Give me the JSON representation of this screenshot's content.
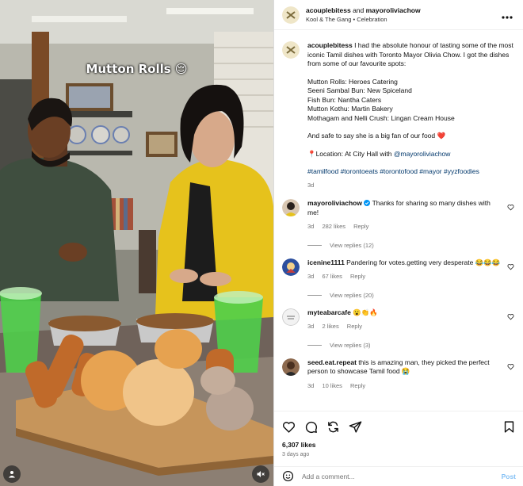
{
  "media": {
    "overlay_text": "Mutton Rolls 😌",
    "icons": [
      "user-icon",
      "mute-icon"
    ]
  },
  "header": {
    "user1": "acouplebitess",
    "and_text": "and",
    "user2": "mayoroliviachow",
    "audio": "Kool & The Gang",
    "separator": "•",
    "audio_tag": "Celebration"
  },
  "caption": {
    "username": "acouplebitess",
    "intro": "I had the absolute honour of tasting some of the most iconic Tamil dishes with Toronto Mayor Olivia Chow. I got the dishes from some of our favourite spots:",
    "spots": [
      "Mutton Rolls: Heroes Catering",
      "Seeni Sambal Bun: New Spiceland",
      "Fish Bun: Nantha Caters",
      "Mutton Kothu: Martin Bakery",
      "Mothagam and Nelli Crush: Lingan Cream House"
    ],
    "fan_line": "And safe to say she is a big fan of our food ❤️",
    "location_prefix": "📍Location: At City Hall with",
    "location_mention": "@mayoroliviachow",
    "hashtags": "#tamilfood #torontoeats #torontofood #mayor #yyzfoodies",
    "time": "3d"
  },
  "comments": [
    {
      "username": "mayoroliviachow",
      "verified": true,
      "text": "Thanks for sharing so many dishes with me!",
      "time": "3d",
      "likes": "282 likes",
      "reply": "Reply",
      "view_replies": "View replies (12)"
    },
    {
      "username": "icenine1111",
      "text": "Pandering for votes.getting very desperate 😂😂😂",
      "time": "3d",
      "likes": "67 likes",
      "reply": "Reply",
      "view_replies": "View replies (20)"
    },
    {
      "username": "myteabarcafe",
      "text": "😮👏🔥",
      "time": "3d",
      "likes": "2 likes",
      "reply": "Reply",
      "view_replies": "View replies (3)"
    },
    {
      "username": "seed.eat.repeat",
      "text": "this is amazing man, they picked the perfect person to showcase Tamil food 😭",
      "time": "3d",
      "likes": "10 likes",
      "reply": "Reply"
    }
  ],
  "actions": {
    "icons": [
      "heart-icon",
      "comment-icon",
      "share-icon",
      "send-icon",
      "bookmark-icon"
    ],
    "likes": "6,307 likes",
    "ago": "3 days ago"
  },
  "add_comment": {
    "placeholder": "Add a comment...",
    "post_label": "Post"
  },
  "colors": {
    "link": "#00376b",
    "muted": "#737373",
    "post": "#85c1f5",
    "verified": "#0095f6",
    "jacket": "#e6c21c"
  }
}
